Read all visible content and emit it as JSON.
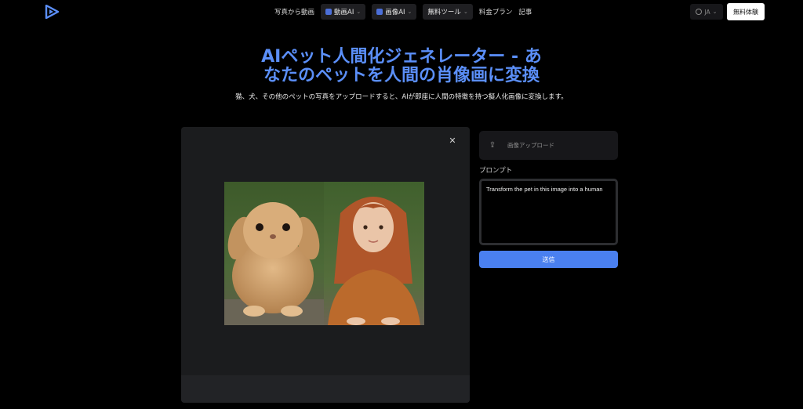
{
  "header": {
    "logo_icon": "play-logo-icon",
    "nav": {
      "photo_to_video": "写真から動画",
      "video_ai": "動画AI",
      "image_ai": "画像AI",
      "free_tools": "無料ツール",
      "pricing": "料金プラン",
      "blog": "記事"
    },
    "language": "JA",
    "cta": "無料体験"
  },
  "hero": {
    "title_line1": "AIペット人間化ジェネレーター - あ",
    "title_line2": "なたのペットを人間の肖像画に変換",
    "subtitle": "猫、犬、その他のペットの写真をアップロードすると、AIが即座に人間の特徴を持つ擬人化画像に変換します。"
  },
  "preview": {
    "close_icon": "close-icon",
    "image": "rabbit-and-human-portrait"
  },
  "form": {
    "upload_label": "画像アップロード",
    "upload_icon": "upload-icon",
    "prompt_label": "プロンプト",
    "prompt_value": "Transform the pet in this image into a human",
    "submit_label": "送信"
  },
  "colors": {
    "accent": "#5b8ff9",
    "button": "#4a80f0",
    "background": "#000000"
  }
}
